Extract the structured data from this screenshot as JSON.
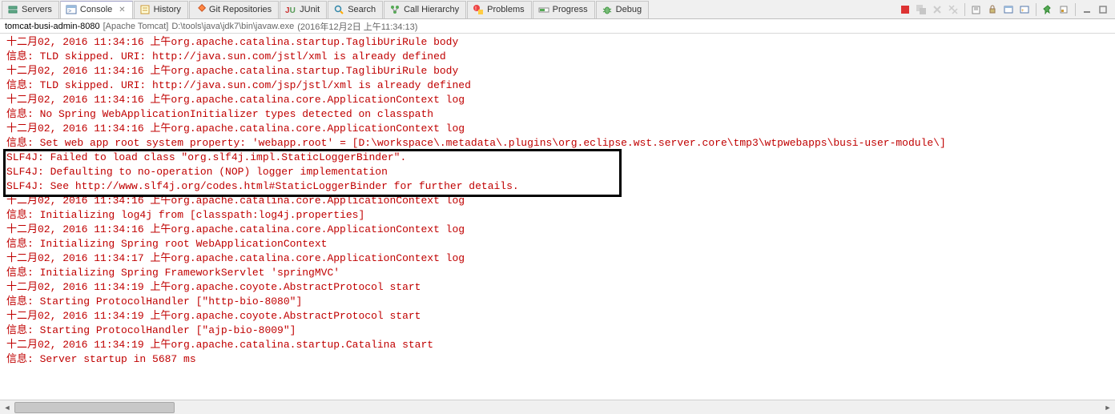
{
  "tabs": [
    {
      "label": "Servers",
      "icon": "servers"
    },
    {
      "label": "Console",
      "icon": "console",
      "active": true
    },
    {
      "label": "History",
      "icon": "history"
    },
    {
      "label": "Git Repositories",
      "icon": "git"
    },
    {
      "label": "JUnit",
      "icon": "junit"
    },
    {
      "label": "Search",
      "icon": "search"
    },
    {
      "label": "Call Hierarchy",
      "icon": "callhier"
    },
    {
      "label": "Problems",
      "icon": "problems"
    },
    {
      "label": "Progress",
      "icon": "progress"
    },
    {
      "label": "Debug",
      "icon": "debug"
    }
  ],
  "infoline": {
    "server": "tomcat-busi-admin-8080",
    "type": "[Apache Tomcat]",
    "path": "D:\\tools\\java\\jdk7\\bin\\javaw.exe",
    "timestamp": "(2016年12月2日 上午11:34:13)"
  },
  "toolbar_icons": [
    "terminate",
    "stop-all",
    "remove",
    "remove-all",
    "scroll-lock",
    "word-wrap",
    "display-selected",
    "open-console",
    "pin",
    "min",
    "max"
  ],
  "console_lines": [
    "十二月02, 2016 11:34:16 上午org.apache.catalina.startup.TaglibUriRule body",
    "信息: TLD skipped. URI: http://java.sun.com/jstl/xml is already defined",
    "十二月02, 2016 11:34:16 上午org.apache.catalina.startup.TaglibUriRule body",
    "信息: TLD skipped. URI: http://java.sun.com/jsp/jstl/xml is already defined",
    "十二月02, 2016 11:34:16 上午org.apache.catalina.core.ApplicationContext log",
    "信息: No Spring WebApplicationInitializer types detected on classpath",
    "十二月02, 2016 11:34:16 上午org.apache.catalina.core.ApplicationContext log",
    "信息: Set web app root system property: 'webapp.root' = [D:\\workspace\\.metadata\\.plugins\\org.eclipse.wst.server.core\\tmp3\\wtpwebapps\\busi-user-module\\]",
    "SLF4J: Failed to load class \"org.slf4j.impl.StaticLoggerBinder\".",
    "SLF4J: Defaulting to no-operation (NOP) logger implementation",
    "SLF4J: See http://www.slf4j.org/codes.html#StaticLoggerBinder for further details.",
    "十二月02, 2016 11:34:16 上午org.apache.catalina.core.ApplicationContext log",
    "信息: Initializing log4j from [classpath:log4j.properties]",
    "十二月02, 2016 11:34:16 上午org.apache.catalina.core.ApplicationContext log",
    "信息: Initializing Spring root WebApplicationContext",
    "十二月02, 2016 11:34:17 上午org.apache.catalina.core.ApplicationContext log",
    "信息: Initializing Spring FrameworkServlet 'springMVC'",
    "十二月02, 2016 11:34:19 上午org.apache.coyote.AbstractProtocol start",
    "信息: Starting ProtocolHandler [\"http-bio-8080\"]",
    "十二月02, 2016 11:34:19 上午org.apache.coyote.AbstractProtocol start",
    "信息: Starting ProtocolHandler [\"ajp-bio-8009\"]",
    "十二月02, 2016 11:34:19 上午org.apache.catalina.startup.Catalina start",
    "信息: Server startup in 5687 ms"
  ]
}
